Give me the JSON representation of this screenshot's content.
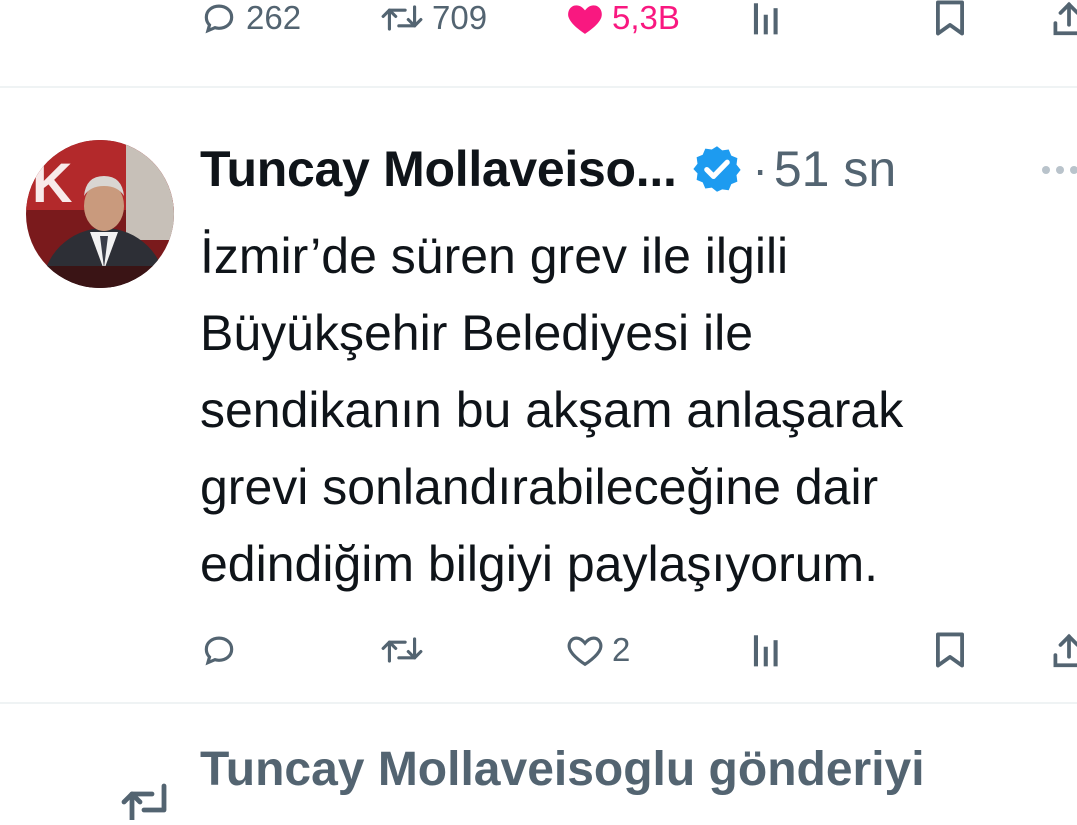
{
  "previous_tweet": {
    "actions": {
      "reply_count": "262",
      "retweet_count": "709",
      "like_count": "5,3B",
      "views_count": "",
      "bookmark": "",
      "share": ""
    }
  },
  "tweet": {
    "author_name": "Tuncay Mollaveiso...",
    "verified": true,
    "separator": "·",
    "timestamp": "51 sn",
    "text_lines": [
      "İzmir’de süren grev ile ilgili",
      "Büyükşehir Belediyesi ile",
      "sendikanın bu akşam anlaşarak",
      "grevi sonlandırabileceğine dair",
      "edindiğim bilgiyi paylaşıyorum."
    ],
    "actions": {
      "reply_count": "",
      "retweet_count": "",
      "like_count": "2",
      "views_count": "",
      "bookmark": "",
      "share": ""
    }
  },
  "retweet_notice": {
    "text": "Tuncay Mollaveisoglu gönderiyi"
  },
  "colors": {
    "text_primary": "#0f1419",
    "text_secondary": "#536471",
    "like_pink": "#f91880",
    "verified_blue": "#1d9bf0",
    "divider": "#eff3f4"
  },
  "icons": {
    "reply": "reply-icon",
    "retweet": "retweet-icon",
    "like": "heart-icon",
    "views": "views-icon",
    "bookmark": "bookmark-icon",
    "share": "share-icon",
    "verified": "verified-badge-icon",
    "more": "more-options-icon"
  }
}
